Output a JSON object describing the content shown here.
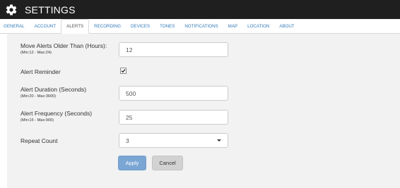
{
  "titlebar": {
    "title": "SETTINGS",
    "icon": "gear-icon"
  },
  "tabs": [
    {
      "label": "GENERAL",
      "active": false
    },
    {
      "label": "ACCOUNT",
      "active": false
    },
    {
      "label": "ALERTS",
      "active": true
    },
    {
      "label": "RECORDING",
      "active": false
    },
    {
      "label": "DEVICES",
      "active": false
    },
    {
      "label": "TONES",
      "active": false
    },
    {
      "label": "NOTIFICATIONS",
      "active": false
    },
    {
      "label": "MAP",
      "active": false
    },
    {
      "label": "LOCATION",
      "active": false
    },
    {
      "label": "ABOUT",
      "active": false
    }
  ],
  "form": {
    "move_alerts": {
      "label": "Move Alerts Older Than (Hours):",
      "hint": "(Min:12 - Max:24)",
      "value": "12"
    },
    "alert_reminder": {
      "label": "Alert Reminder",
      "checked": true
    },
    "alert_duration": {
      "label": "Alert Duration (Seconds)",
      "hint": "(Min:20 - Max:3600)",
      "value": "500"
    },
    "alert_frequency": {
      "label": "Alert Frequency (Seconds)",
      "hint": "(Min:15 - Max:900)",
      "value": "25"
    },
    "repeat_count": {
      "label": "Repeat Count",
      "value": "3"
    }
  },
  "buttons": {
    "apply": "Apply",
    "cancel": "Cancel"
  },
  "colors": {
    "titlebar_bg": "#1f1f1f",
    "tab_link": "#337ab7",
    "panel_bg": "#f2f2f2",
    "apply_bg": "#7aa6d4",
    "cancel_bg": "#d2d2d2"
  }
}
